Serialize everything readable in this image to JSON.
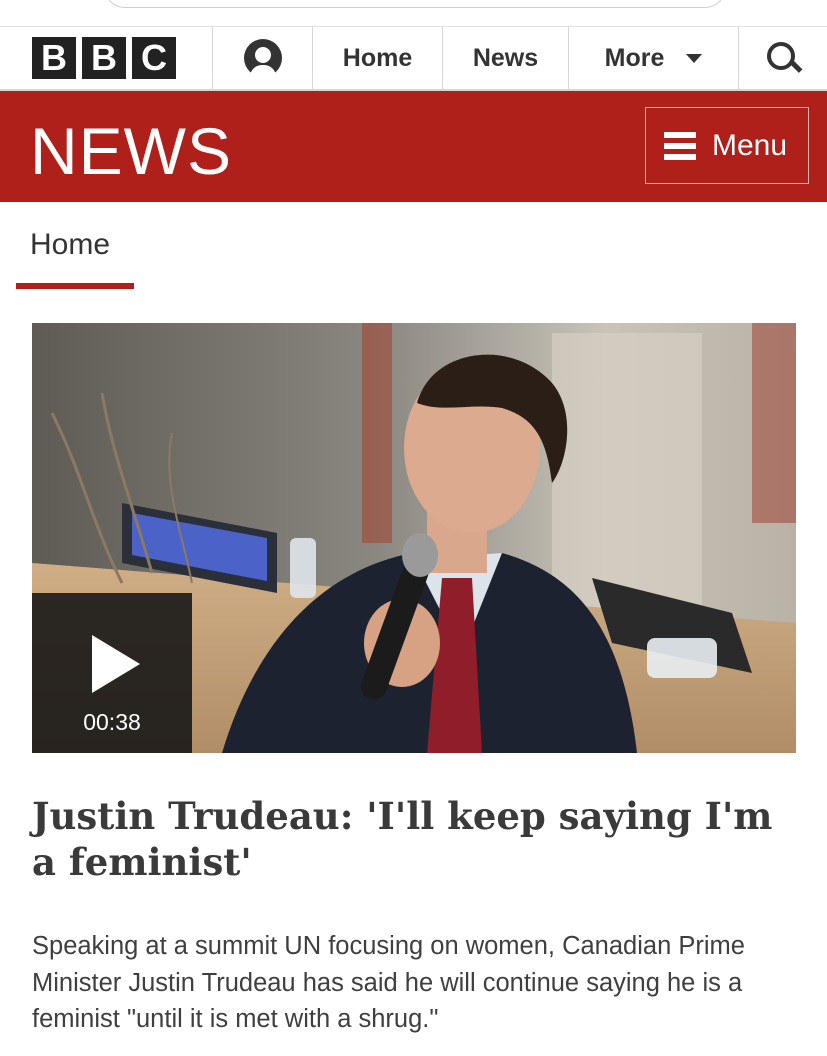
{
  "masthead": {
    "logo_letters": [
      "B",
      "B",
      "C"
    ],
    "nav": [
      {
        "label": "Home"
      },
      {
        "label": "News"
      },
      {
        "label": "More"
      }
    ],
    "icons": {
      "account": "account-icon",
      "search": "search-icon",
      "more_dropdown": "chevron-down-icon"
    }
  },
  "news_band": {
    "wordmark": "NEWS",
    "menu_label": "Menu",
    "color": "#b0201a"
  },
  "subnav": {
    "active_label": "Home"
  },
  "article": {
    "media_duration": "00:38",
    "headline": "Justin Trudeau: 'I'll keep saying I'm a feminist'",
    "summary": "Speaking at a summit UN focusing on women, Canadian Prime Minister Justin Trudeau has said he will continue saying he is a feminist \"until it is met with a shrug.\""
  }
}
